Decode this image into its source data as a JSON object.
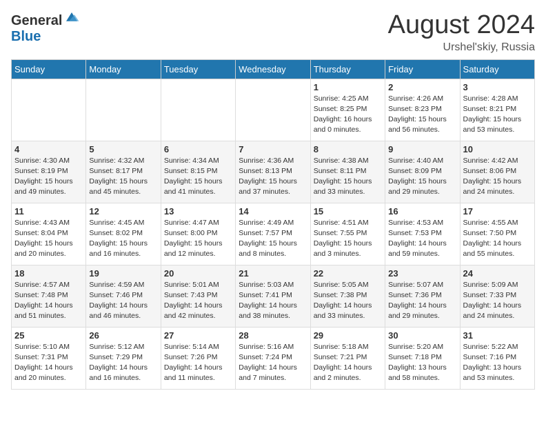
{
  "header": {
    "logo_general": "General",
    "logo_blue": "Blue",
    "month_title": "August 2024",
    "location": "Urshel'skiy, Russia"
  },
  "days_of_week": [
    "Sunday",
    "Monday",
    "Tuesday",
    "Wednesday",
    "Thursday",
    "Friday",
    "Saturday"
  ],
  "weeks": [
    [
      {
        "day": "",
        "info": ""
      },
      {
        "day": "",
        "info": ""
      },
      {
        "day": "",
        "info": ""
      },
      {
        "day": "",
        "info": ""
      },
      {
        "day": "1",
        "info": "Sunrise: 4:25 AM\nSunset: 8:25 PM\nDaylight: 16 hours\nand 0 minutes."
      },
      {
        "day": "2",
        "info": "Sunrise: 4:26 AM\nSunset: 8:23 PM\nDaylight: 15 hours\nand 56 minutes."
      },
      {
        "day": "3",
        "info": "Sunrise: 4:28 AM\nSunset: 8:21 PM\nDaylight: 15 hours\nand 53 minutes."
      }
    ],
    [
      {
        "day": "4",
        "info": "Sunrise: 4:30 AM\nSunset: 8:19 PM\nDaylight: 15 hours\nand 49 minutes."
      },
      {
        "day": "5",
        "info": "Sunrise: 4:32 AM\nSunset: 8:17 PM\nDaylight: 15 hours\nand 45 minutes."
      },
      {
        "day": "6",
        "info": "Sunrise: 4:34 AM\nSunset: 8:15 PM\nDaylight: 15 hours\nand 41 minutes."
      },
      {
        "day": "7",
        "info": "Sunrise: 4:36 AM\nSunset: 8:13 PM\nDaylight: 15 hours\nand 37 minutes."
      },
      {
        "day": "8",
        "info": "Sunrise: 4:38 AM\nSunset: 8:11 PM\nDaylight: 15 hours\nand 33 minutes."
      },
      {
        "day": "9",
        "info": "Sunrise: 4:40 AM\nSunset: 8:09 PM\nDaylight: 15 hours\nand 29 minutes."
      },
      {
        "day": "10",
        "info": "Sunrise: 4:42 AM\nSunset: 8:06 PM\nDaylight: 15 hours\nand 24 minutes."
      }
    ],
    [
      {
        "day": "11",
        "info": "Sunrise: 4:43 AM\nSunset: 8:04 PM\nDaylight: 15 hours\nand 20 minutes."
      },
      {
        "day": "12",
        "info": "Sunrise: 4:45 AM\nSunset: 8:02 PM\nDaylight: 15 hours\nand 16 minutes."
      },
      {
        "day": "13",
        "info": "Sunrise: 4:47 AM\nSunset: 8:00 PM\nDaylight: 15 hours\nand 12 minutes."
      },
      {
        "day": "14",
        "info": "Sunrise: 4:49 AM\nSunset: 7:57 PM\nDaylight: 15 hours\nand 8 minutes."
      },
      {
        "day": "15",
        "info": "Sunrise: 4:51 AM\nSunset: 7:55 PM\nDaylight: 15 hours\nand 3 minutes."
      },
      {
        "day": "16",
        "info": "Sunrise: 4:53 AM\nSunset: 7:53 PM\nDaylight: 14 hours\nand 59 minutes."
      },
      {
        "day": "17",
        "info": "Sunrise: 4:55 AM\nSunset: 7:50 PM\nDaylight: 14 hours\nand 55 minutes."
      }
    ],
    [
      {
        "day": "18",
        "info": "Sunrise: 4:57 AM\nSunset: 7:48 PM\nDaylight: 14 hours\nand 51 minutes."
      },
      {
        "day": "19",
        "info": "Sunrise: 4:59 AM\nSunset: 7:46 PM\nDaylight: 14 hours\nand 46 minutes."
      },
      {
        "day": "20",
        "info": "Sunrise: 5:01 AM\nSunset: 7:43 PM\nDaylight: 14 hours\nand 42 minutes."
      },
      {
        "day": "21",
        "info": "Sunrise: 5:03 AM\nSunset: 7:41 PM\nDaylight: 14 hours\nand 38 minutes."
      },
      {
        "day": "22",
        "info": "Sunrise: 5:05 AM\nSunset: 7:38 PM\nDaylight: 14 hours\nand 33 minutes."
      },
      {
        "day": "23",
        "info": "Sunrise: 5:07 AM\nSunset: 7:36 PM\nDaylight: 14 hours\nand 29 minutes."
      },
      {
        "day": "24",
        "info": "Sunrise: 5:09 AM\nSunset: 7:33 PM\nDaylight: 14 hours\nand 24 minutes."
      }
    ],
    [
      {
        "day": "25",
        "info": "Sunrise: 5:10 AM\nSunset: 7:31 PM\nDaylight: 14 hours\nand 20 minutes."
      },
      {
        "day": "26",
        "info": "Sunrise: 5:12 AM\nSunset: 7:29 PM\nDaylight: 14 hours\nand 16 minutes."
      },
      {
        "day": "27",
        "info": "Sunrise: 5:14 AM\nSunset: 7:26 PM\nDaylight: 14 hours\nand 11 minutes."
      },
      {
        "day": "28",
        "info": "Sunrise: 5:16 AM\nSunset: 7:24 PM\nDaylight: 14 hours\nand 7 minutes."
      },
      {
        "day": "29",
        "info": "Sunrise: 5:18 AM\nSunset: 7:21 PM\nDaylight: 14 hours\nand 2 minutes."
      },
      {
        "day": "30",
        "info": "Sunrise: 5:20 AM\nSunset: 7:18 PM\nDaylight: 13 hours\nand 58 minutes."
      },
      {
        "day": "31",
        "info": "Sunrise: 5:22 AM\nSunset: 7:16 PM\nDaylight: 13 hours\nand 53 minutes."
      }
    ]
  ]
}
